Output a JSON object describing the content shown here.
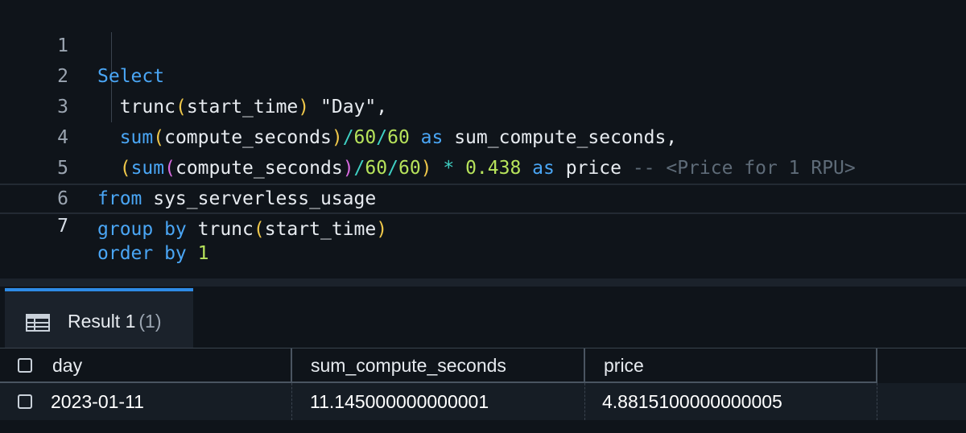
{
  "editor": {
    "line_numbers": [
      "1",
      "2",
      "3",
      "4",
      "5",
      "6",
      "7"
    ],
    "lines": {
      "l1": {
        "kw_select": "Select"
      },
      "l2": {
        "fn": "trunc",
        "p1": "(",
        "arg": "start_time",
        "p2": ")",
        "str": " \"Day\","
      },
      "l3": {
        "fn": "sum",
        "p1": "(",
        "arg": "compute_seconds",
        "p2": ")",
        "op": "/",
        "n1": "60",
        "op2": "/",
        "n2": "60",
        "kw_as": " as ",
        "alias": "sum_compute_seconds,"
      },
      "l4": {
        "p0": "(",
        "fn": "sum",
        "p1": "(",
        "arg": "compute_seconds",
        "p2": ")",
        "op": "/",
        "n1": "60",
        "op2": "/",
        "n2": "60",
        "p3": ")",
        "op3": " * ",
        "n3": "0.438",
        "kw_as": " as ",
        "alias": "price ",
        "comment": "-- <Price for 1 RPU>"
      },
      "l5": {
        "kw_from": "from",
        "table": " sys_serverless_usage"
      },
      "l6": {
        "kw_group": "group by",
        "fn": " trunc",
        "p1": "(",
        "arg": "start_time",
        "p2": ")"
      },
      "l7": {
        "kw_order": "order by",
        "num": " 1"
      }
    }
  },
  "results": {
    "tab_label": "Result 1",
    "tab_count": "(1)",
    "tab_icon": "table-icon",
    "columns": [
      "day",
      "sum_compute_seconds",
      "price"
    ],
    "rows": [
      [
        "2023-01-11",
        "11.145000000000001",
        "4.8815100000000005"
      ]
    ]
  },
  "colors": {
    "keyword": "#4aa6f5",
    "paren": "#f0c84a",
    "number": "#b7e35b",
    "comment": "#5e6b78",
    "tab_accent": "#2e8be6"
  }
}
